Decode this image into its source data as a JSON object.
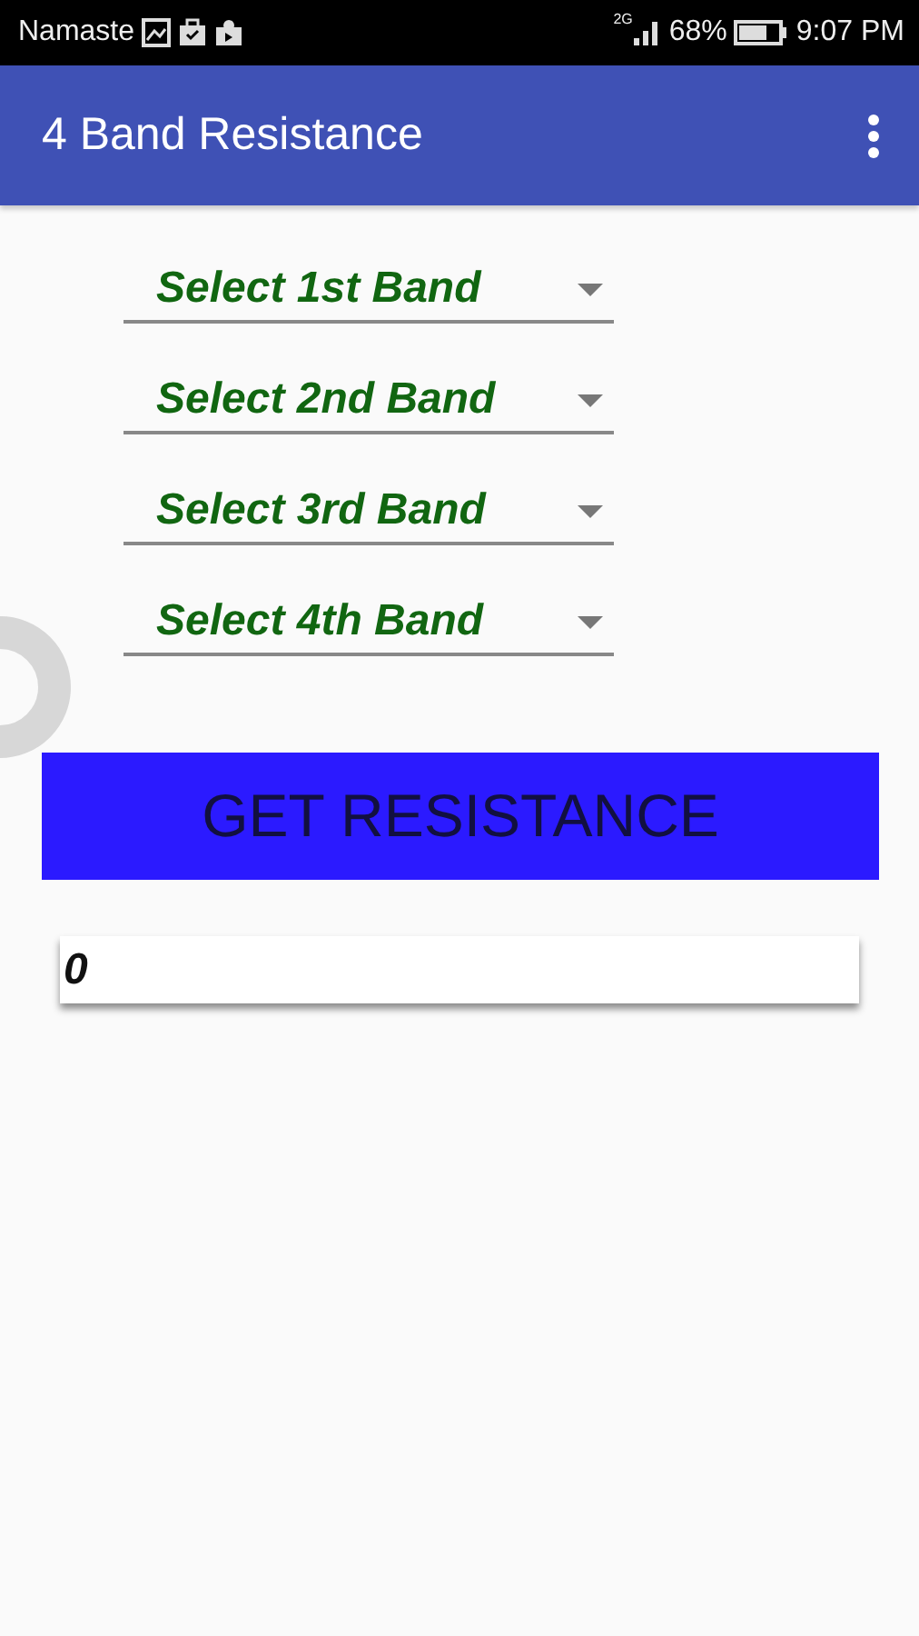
{
  "status_bar": {
    "carrier": "Namaste",
    "network": "2G",
    "battery": "68%",
    "time": "9:07 PM"
  },
  "app_bar": {
    "title": "4 Band Resistance"
  },
  "spinners": [
    {
      "label": "Select 1st Band"
    },
    {
      "label": "Select 2nd Band"
    },
    {
      "label": "Select 3rd Band"
    },
    {
      "label": "Select 4th Band"
    }
  ],
  "button": {
    "label": "GET RESISTANCE"
  },
  "result": {
    "value": "0"
  }
}
